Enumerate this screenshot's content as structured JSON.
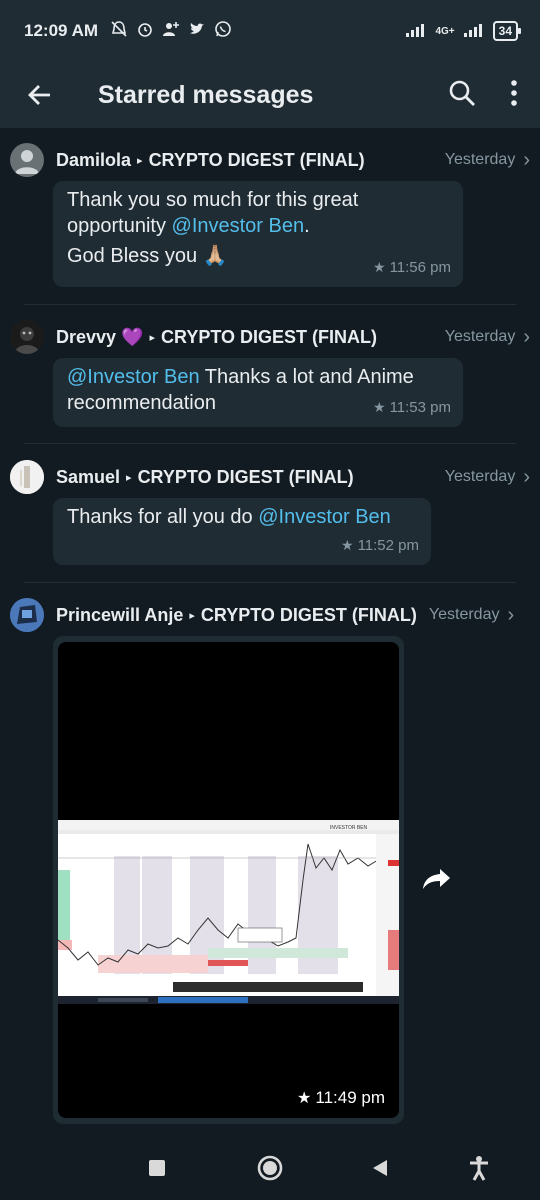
{
  "status_bar": {
    "time": "12:09 AM",
    "icons": [
      "muted-bell-icon",
      "alarm-icon",
      "add-person-icon",
      "twitter-icon",
      "whatsapp-icon"
    ],
    "network": "4G+",
    "battery": "34"
  },
  "app_bar": {
    "title": "Starred messages",
    "icons": [
      "back-arrow-icon",
      "search-icon",
      "more-vert-icon"
    ]
  },
  "messages": [
    {
      "sender": "Damilola",
      "group": "CRYPTO DIGEST (FINAL)",
      "when": "Yesterday",
      "line1": "Thank you so much for this great",
      "line2_pre": "opportunity ",
      "mention": "@Investor Ben",
      "line2_post": ".",
      "line3": "God Bless you 🙏🏼",
      "time": "11:56 pm"
    },
    {
      "sender": "Drevvy 💜",
      "group": "CRYPTO DIGEST (FINAL)",
      "when": "Yesterday",
      "mention": "@Investor Ben",
      "line1_post": " Thanks a lot and Anime",
      "line2": "recommendation",
      "time": "11:53 pm"
    },
    {
      "sender": "Samuel",
      "group": "CRYPTO DIGEST (FINAL)",
      "when": "Yesterday",
      "text_pre": "Thanks for all you do ",
      "mention": "@Investor Ben",
      "time": "11:52 pm"
    },
    {
      "sender": "Princewill Anje",
      "group": "CRYPTO DIGEST (FINAL)",
      "when": "Yesterday",
      "media": "image",
      "chart_watermark": "INVESTOR BEN",
      "time": "11:49 pm"
    }
  ],
  "colors": {
    "background": "#111b21",
    "header": "#1f2c34",
    "bubble": "#202c33",
    "mention": "#53bdeb",
    "secondary_text": "#8696a0"
  },
  "nav_bar": {
    "icons": [
      "recents-square-icon",
      "home-circle-icon",
      "back-triangle-icon",
      "accessibility-icon"
    ]
  }
}
